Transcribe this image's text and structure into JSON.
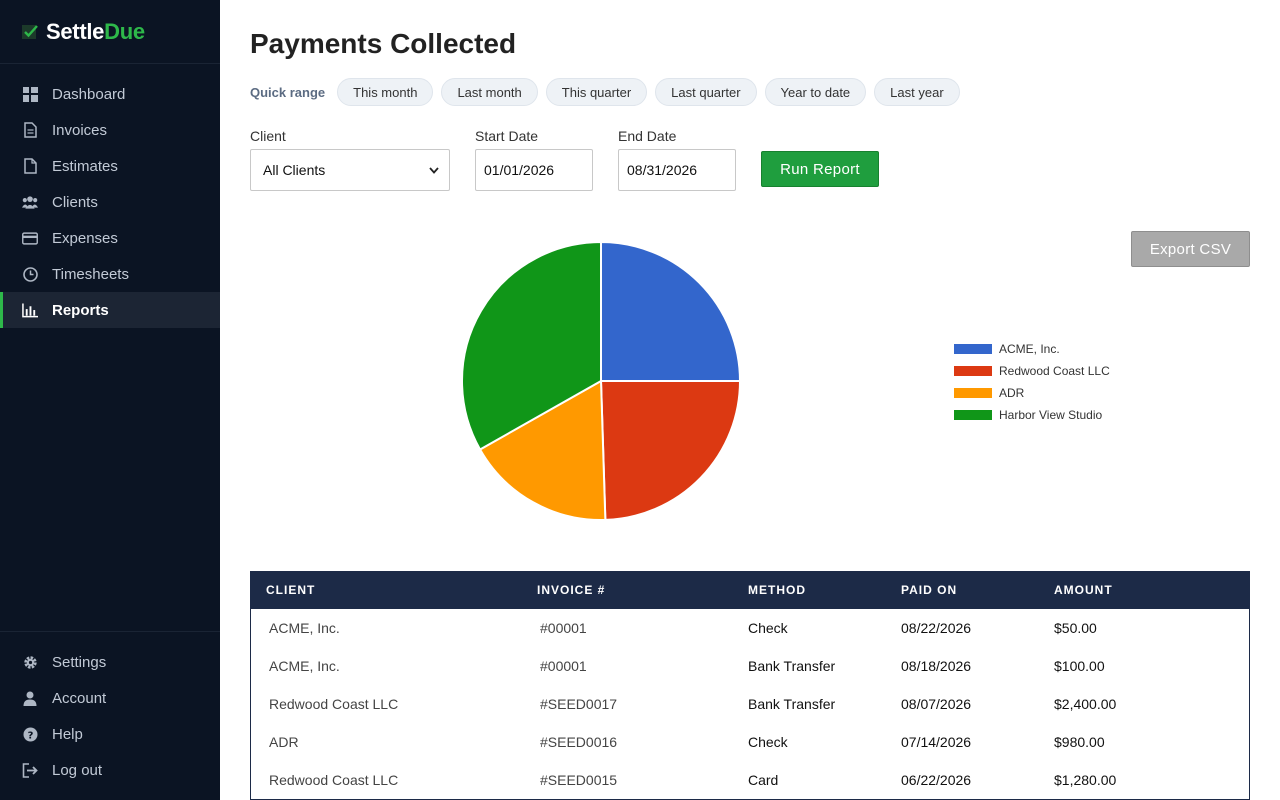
{
  "brand": {
    "name_a": "Settle",
    "name_b": "Due"
  },
  "nav": {
    "items": [
      {
        "label": "Dashboard",
        "icon": "grid-icon"
      },
      {
        "label": "Invoices",
        "icon": "document-icon"
      },
      {
        "label": "Estimates",
        "icon": "file-icon"
      },
      {
        "label": "Clients",
        "icon": "users-icon"
      },
      {
        "label": "Expenses",
        "icon": "credit-card-icon"
      },
      {
        "label": "Timesheets",
        "icon": "clock-icon"
      },
      {
        "label": "Reports",
        "icon": "bar-chart-icon",
        "active": true
      }
    ],
    "bottom": [
      {
        "label": "Settings",
        "icon": "gear-icon"
      },
      {
        "label": "Account",
        "icon": "user-icon"
      },
      {
        "label": "Help",
        "icon": "question-icon"
      },
      {
        "label": "Log out",
        "icon": "logout-icon"
      }
    ]
  },
  "page": {
    "title": "Payments Collected"
  },
  "quick_range": {
    "label": "Quick range",
    "options": [
      "This month",
      "Last month",
      "This quarter",
      "Last quarter",
      "Year to date",
      "Last year"
    ]
  },
  "filters": {
    "client_label": "Client",
    "client_value": "All Clients",
    "start_label": "Start Date",
    "start_value": "01/01/2026",
    "end_label": "End Date",
    "end_value": "08/31/2026",
    "run_label": "Run Report",
    "export_label": "Export CSV"
  },
  "chart_data": {
    "type": "pie",
    "categories": [
      "ACME, Inc.",
      "Redwood Coast LLC",
      "ADR",
      "Harbor View Studio"
    ],
    "values": [
      25.0,
      24.5,
      17.3,
      33.2
    ],
    "colors": [
      "#3366cc",
      "#dc3912",
      "#ff9900",
      "#109618"
    ],
    "legend": "right"
  },
  "table": {
    "headers": [
      "CLIENT",
      "INVOICE #",
      "METHOD",
      "PAID ON",
      "AMOUNT"
    ],
    "rows": [
      [
        "ACME, Inc.",
        "#00001",
        "Check",
        "08/22/2026",
        "$50.00"
      ],
      [
        "ACME, Inc.",
        "#00001",
        "Bank Transfer",
        "08/18/2026",
        "$100.00"
      ],
      [
        "Redwood Coast LLC",
        "#SEED0017",
        "Bank Transfer",
        "08/07/2026",
        "$2,400.00"
      ],
      [
        "ADR",
        "#SEED0016",
        "Check",
        "07/14/2026",
        "$980.00"
      ],
      [
        "Redwood Coast LLC",
        "#SEED0015",
        "Card",
        "06/22/2026",
        "$1,280.00"
      ]
    ]
  }
}
